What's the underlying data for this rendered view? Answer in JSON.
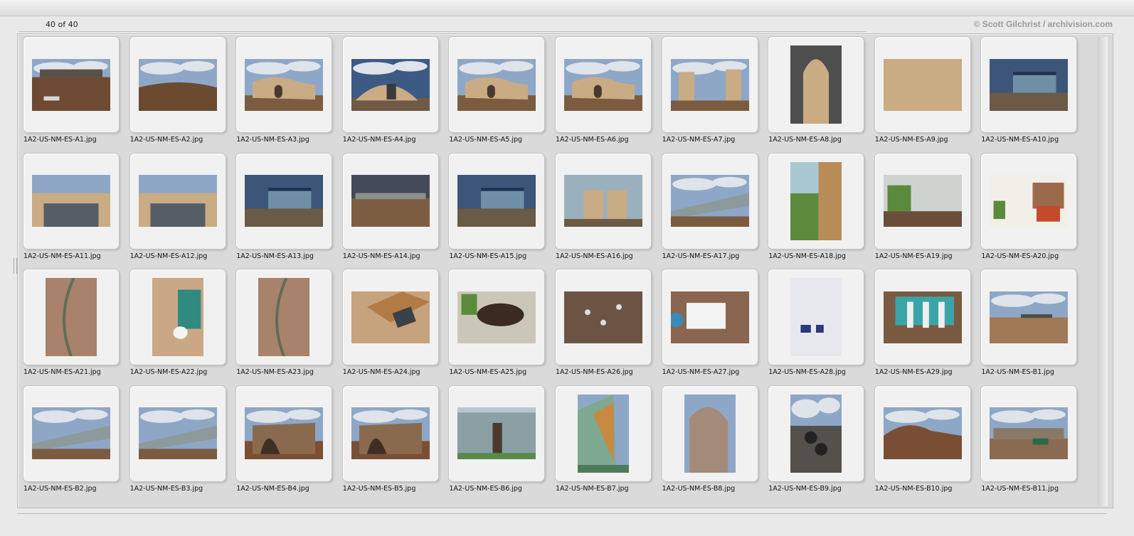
{
  "header": {
    "count_text": "40 of 40",
    "credit": "© Scott Gilchrist / archivision.com"
  },
  "thumbnails": [
    {
      "file": "1A2-US-NM-ES-A1.jpg",
      "orientation": "landscape",
      "scene": "flat-roof"
    },
    {
      "file": "1A2-US-NM-ES-A2.jpg",
      "orientation": "landscape",
      "scene": "berm"
    },
    {
      "file": "1A2-US-NM-ES-A3.jpg",
      "orientation": "landscape",
      "scene": "adobe"
    },
    {
      "file": "1A2-US-NM-ES-A4.jpg",
      "orientation": "landscape",
      "scene": "adobe-blue"
    },
    {
      "file": "1A2-US-NM-ES-A5.jpg",
      "orientation": "landscape",
      "scene": "adobe"
    },
    {
      "file": "1A2-US-NM-ES-A6.jpg",
      "orientation": "landscape",
      "scene": "adobe"
    },
    {
      "file": "1A2-US-NM-ES-A7.jpg",
      "orientation": "landscape",
      "scene": "bottle-wall"
    },
    {
      "file": "1A2-US-NM-ES-A8.jpg",
      "orientation": "portrait",
      "scene": "bottle-tower"
    },
    {
      "file": "1A2-US-NM-ES-A9.jpg",
      "orientation": "landscape",
      "scene": "bottle-closeup"
    },
    {
      "file": "1A2-US-NM-ES-A10.jpg",
      "orientation": "landscape",
      "scene": "solar-front"
    },
    {
      "file": "1A2-US-NM-ES-A11.jpg",
      "orientation": "landscape",
      "scene": "greenhouse-roof"
    },
    {
      "file": "1A2-US-NM-ES-A12.jpg",
      "orientation": "landscape",
      "scene": "greenhouse-roof"
    },
    {
      "file": "1A2-US-NM-ES-A13.jpg",
      "orientation": "landscape",
      "scene": "solar-front"
    },
    {
      "file": "1A2-US-NM-ES-A14.jpg",
      "orientation": "landscape",
      "scene": "dirt-front"
    },
    {
      "file": "1A2-US-NM-ES-A15.jpg",
      "orientation": "landscape",
      "scene": "solar-front"
    },
    {
      "file": "1A2-US-NM-ES-A16.jpg",
      "orientation": "landscape",
      "scene": "facade-blue"
    },
    {
      "file": "1A2-US-NM-ES-A17.jpg",
      "orientation": "landscape",
      "scene": "greenhouse-long"
    },
    {
      "file": "1A2-US-NM-ES-A18.jpg",
      "orientation": "portrait",
      "scene": "interior-plants"
    },
    {
      "file": "1A2-US-NM-ES-A19.jpg",
      "orientation": "landscape",
      "scene": "interior-room"
    },
    {
      "file": "1A2-US-NM-ES-A20.jpg",
      "orientation": "landscape",
      "scene": "interior-bright"
    },
    {
      "file": "1A2-US-NM-ES-A21.jpg",
      "orientation": "portrait",
      "scene": "interior-wall"
    },
    {
      "file": "1A2-US-NM-ES-A22.jpg",
      "orientation": "portrait",
      "scene": "bathroom"
    },
    {
      "file": "1A2-US-NM-ES-A23.jpg",
      "orientation": "portrait",
      "scene": "interior-wall"
    },
    {
      "file": "1A2-US-NM-ES-A24.jpg",
      "orientation": "landscape",
      "scene": "window-wall"
    },
    {
      "file": "1A2-US-NM-ES-A25.jpg",
      "orientation": "landscape",
      "scene": "planter"
    },
    {
      "file": "1A2-US-NM-ES-A26.jpg",
      "orientation": "landscape",
      "scene": "mosaic"
    },
    {
      "file": "1A2-US-NM-ES-A27.jpg",
      "orientation": "landscape",
      "scene": "sign"
    },
    {
      "file": "1A2-US-NM-ES-A28.jpg",
      "orientation": "portrait",
      "scene": "poster"
    },
    {
      "file": "1A2-US-NM-ES-A29.jpg",
      "orientation": "landscape",
      "scene": "filters"
    },
    {
      "file": "1A2-US-NM-ES-B1.jpg",
      "orientation": "landscape",
      "scene": "plain"
    },
    {
      "file": "1A2-US-NM-ES-B2.jpg",
      "orientation": "landscape",
      "scene": "greenhouse-long"
    },
    {
      "file": "1A2-US-NM-ES-B3.jpg",
      "orientation": "landscape",
      "scene": "greenhouse-long"
    },
    {
      "file": "1A2-US-NM-ES-B4.jpg",
      "orientation": "landscape",
      "scene": "arch"
    },
    {
      "file": "1A2-US-NM-ES-B5.jpg",
      "orientation": "landscape",
      "scene": "arch"
    },
    {
      "file": "1A2-US-NM-ES-B6.jpg",
      "orientation": "landscape",
      "scene": "windows-close"
    },
    {
      "file": "1A2-US-NM-ES-B7.jpg",
      "orientation": "portrait",
      "scene": "window-angle"
    },
    {
      "file": "1A2-US-NM-ES-B8.jpg",
      "orientation": "portrait",
      "scene": "adobe-tall"
    },
    {
      "file": "1A2-US-NM-ES-B9.jpg",
      "orientation": "portrait",
      "scene": "tires"
    },
    {
      "file": "1A2-US-NM-ES-B10.jpg",
      "orientation": "landscape",
      "scene": "berm-pile"
    },
    {
      "file": "1A2-US-NM-ES-B11.jpg",
      "orientation": "landscape",
      "scene": "rubble"
    }
  ],
  "colors": {
    "sky": "#8ea7c7",
    "cloud": "#dfe3ea",
    "earth": "#8a5a3a",
    "adobe": "#c9ab84",
    "glass": "#6f8fa6",
    "green": "#5c8a3c"
  }
}
